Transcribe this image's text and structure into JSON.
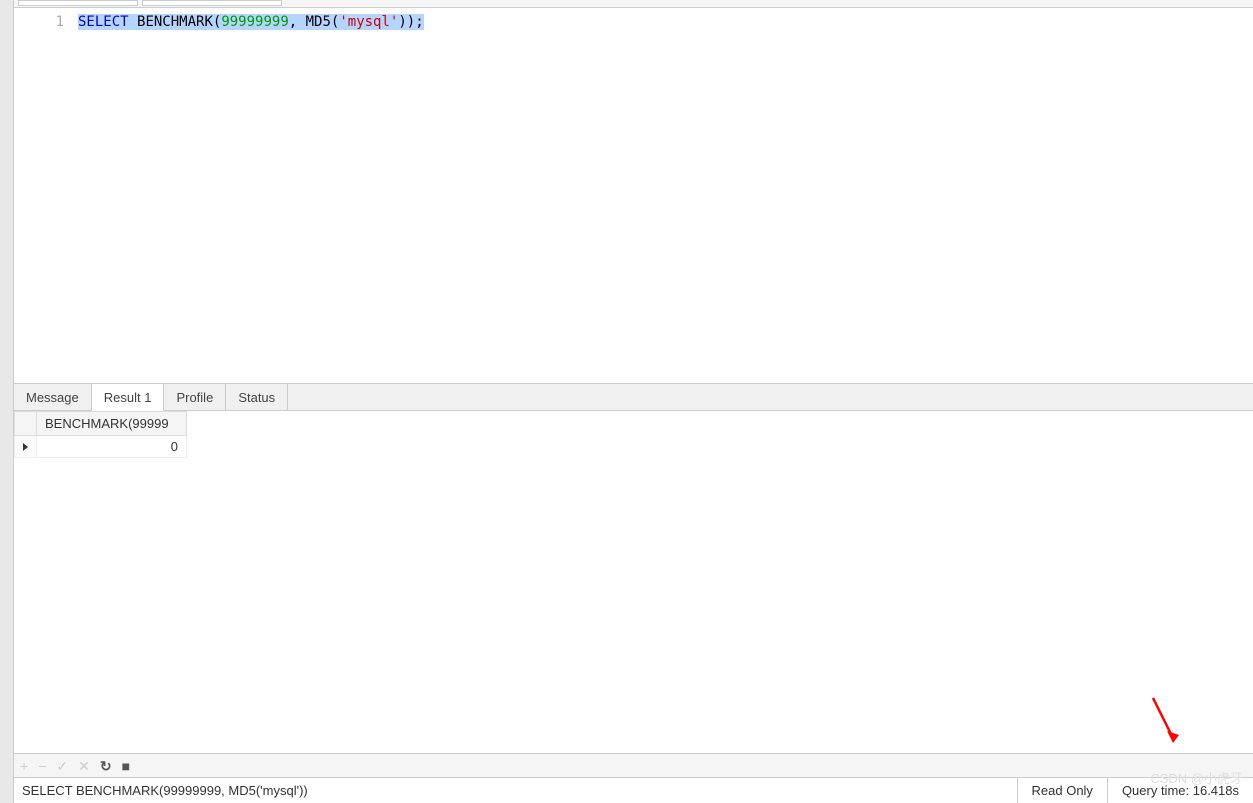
{
  "editor": {
    "line_number": "1",
    "tokens": {
      "select": "SELECT",
      "sp1": " ",
      "benchmark": "BENCHMARK",
      "lp1": "(",
      "num": "99999999",
      "comma": ", ",
      "md5": "MD5",
      "lp2": "(",
      "str": "'mysql'",
      "rp2": ")",
      "rp1": ")",
      "semi": ";"
    }
  },
  "tabs": {
    "message": "Message",
    "result1": "Result 1",
    "profile": "Profile",
    "status": "Status"
  },
  "result": {
    "column_header": "BENCHMARK(99999",
    "row1_value": "0"
  },
  "bottom_toolbar": {
    "add": "+",
    "remove": "−",
    "apply": "✓",
    "cancel": "✕",
    "refresh": "↻",
    "stop": "■"
  },
  "status_bar": {
    "query": "SELECT BENCHMARK(99999999, MD5('mysql'))",
    "readonly": "Read Only",
    "query_time": "Query time: 16.418s"
  },
  "watermark": "CSDN @小虎牙"
}
